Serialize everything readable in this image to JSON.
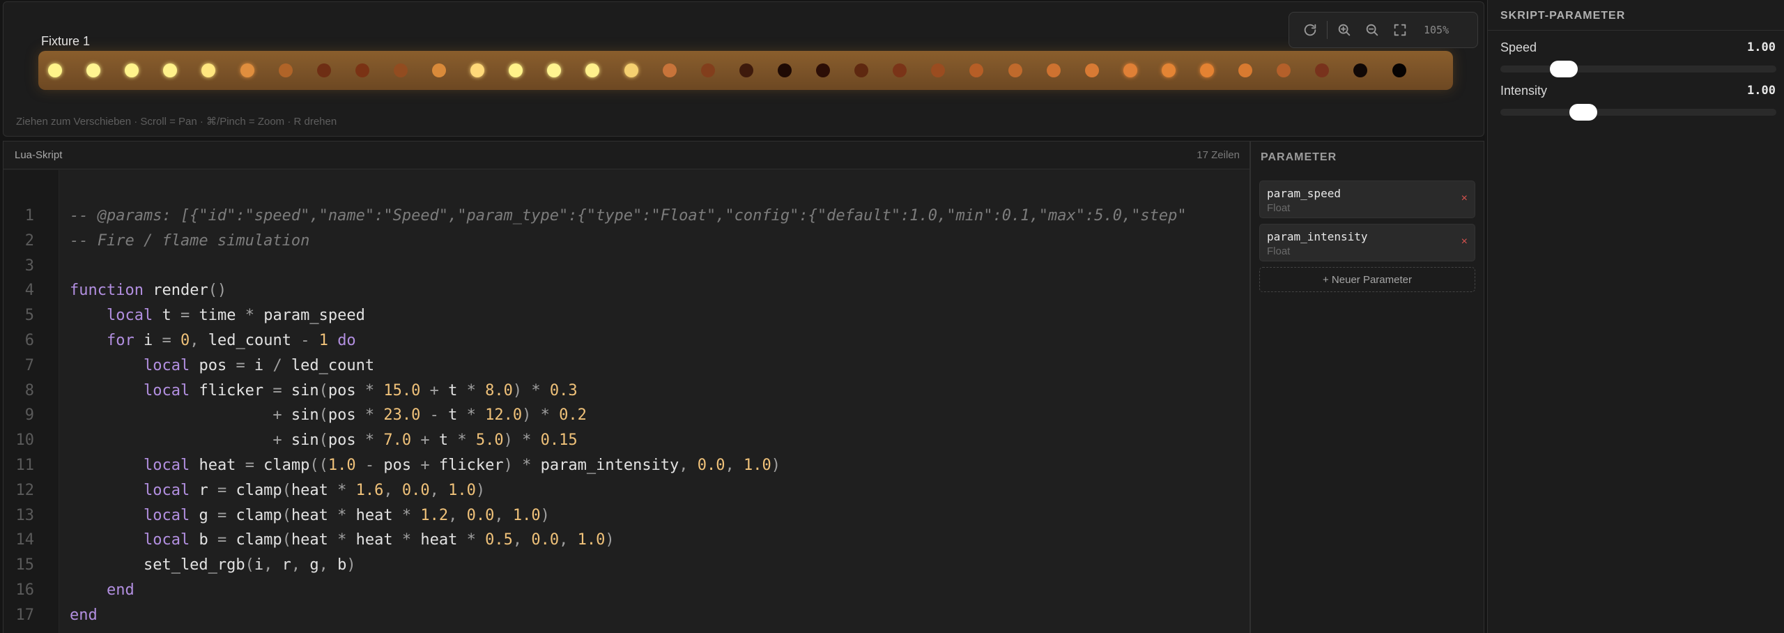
{
  "preview": {
    "fixture_name": "Fixture 1",
    "hint": "Ziehen zum Verschieben · Scroll = Pan · ⌘/Pinch = Zoom · R drehen",
    "zoom": "105%",
    "toolbar_icons": [
      "refresh-icon",
      "zoom-in-icon",
      "zoom-out-icon",
      "fit-screen-icon"
    ],
    "led_colors": [
      "#fff48a",
      "#fff591",
      "#fff48c",
      "#fff18a",
      "#ffe67f",
      "#e08e3e",
      "#b06428",
      "#6e2e14",
      "#7a3214",
      "#924c20",
      "#d98a3a",
      "#ffd979",
      "#fff38a",
      "#fff490",
      "#fff18c",
      "#f5d070",
      "#c8743a",
      "#823e1c",
      "#3e1a0c",
      "#1e0a04",
      "#2c0e06",
      "#5e2810",
      "#7a3418",
      "#9a4c20",
      "#b65e26",
      "#c06a2c",
      "#ce7230",
      "#d87a34",
      "#e08036",
      "#e48434",
      "#e48232",
      "#d87a30",
      "#b4602a",
      "#78321c",
      "#100806",
      "#060302"
    ]
  },
  "editor": {
    "title": "Lua-Skript",
    "line_count_label": "17 Zeilen",
    "line_numbers": [
      "1",
      "2",
      "3",
      "4",
      "5",
      "6",
      "7",
      "8",
      "9",
      "10",
      "11",
      "12",
      "13",
      "14",
      "15",
      "16",
      "17"
    ],
    "lines": [
      [
        [
          "cm",
          "-- @params: [{\"id\":\"speed\",\"name\":\"Speed\",\"param_type\":{\"type\":\"Float\",\"config\":{\"default\":1.0,\"min\":0.1,\"max\":5.0,\"step\""
        ]
      ],
      [
        [
          "cm",
          "-- Fire / flame simulation"
        ]
      ],
      [],
      [
        [
          "kw",
          "function"
        ],
        [
          "tx",
          " render"
        ],
        [
          "op",
          "()"
        ]
      ],
      [
        [
          "tx",
          "    "
        ],
        [
          "kw",
          "local"
        ],
        [
          "tx",
          " t "
        ],
        [
          "op",
          "="
        ],
        [
          "tx",
          " time "
        ],
        [
          "op",
          "*"
        ],
        [
          "tx",
          " param_speed"
        ]
      ],
      [
        [
          "tx",
          "    "
        ],
        [
          "kw",
          "for"
        ],
        [
          "tx",
          " i "
        ],
        [
          "op",
          "="
        ],
        [
          "tx",
          " "
        ],
        [
          "nm",
          "0"
        ],
        [
          "op",
          ","
        ],
        [
          "tx",
          " led_count "
        ],
        [
          "op",
          "-"
        ],
        [
          "tx",
          " "
        ],
        [
          "nm",
          "1"
        ],
        [
          "tx",
          " "
        ],
        [
          "kw",
          "do"
        ]
      ],
      [
        [
          "tx",
          "        "
        ],
        [
          "kw",
          "local"
        ],
        [
          "tx",
          " pos "
        ],
        [
          "op",
          "="
        ],
        [
          "tx",
          " i "
        ],
        [
          "op",
          "/"
        ],
        [
          "tx",
          " led_count"
        ]
      ],
      [
        [
          "tx",
          "        "
        ],
        [
          "kw",
          "local"
        ],
        [
          "tx",
          " flicker "
        ],
        [
          "op",
          "="
        ],
        [
          "tx",
          " sin"
        ],
        [
          "op",
          "("
        ],
        [
          "tx",
          "pos "
        ],
        [
          "op",
          "*"
        ],
        [
          "tx",
          " "
        ],
        [
          "nm",
          "15.0"
        ],
        [
          "tx",
          " "
        ],
        [
          "op",
          "+"
        ],
        [
          "tx",
          " t "
        ],
        [
          "op",
          "*"
        ],
        [
          "tx",
          " "
        ],
        [
          "nm",
          "8.0"
        ],
        [
          "op",
          ")"
        ],
        [
          "tx",
          " "
        ],
        [
          "op",
          "*"
        ],
        [
          "tx",
          " "
        ],
        [
          "nm",
          "0.3"
        ]
      ],
      [
        [
          "tx",
          "                      "
        ],
        [
          "op",
          "+"
        ],
        [
          "tx",
          " sin"
        ],
        [
          "op",
          "("
        ],
        [
          "tx",
          "pos "
        ],
        [
          "op",
          "*"
        ],
        [
          "tx",
          " "
        ],
        [
          "nm",
          "23.0"
        ],
        [
          "tx",
          " "
        ],
        [
          "op",
          "-"
        ],
        [
          "tx",
          " t "
        ],
        [
          "op",
          "*"
        ],
        [
          "tx",
          " "
        ],
        [
          "nm",
          "12.0"
        ],
        [
          "op",
          ")"
        ],
        [
          "tx",
          " "
        ],
        [
          "op",
          "*"
        ],
        [
          "tx",
          " "
        ],
        [
          "nm",
          "0.2"
        ]
      ],
      [
        [
          "tx",
          "                      "
        ],
        [
          "op",
          "+"
        ],
        [
          "tx",
          " sin"
        ],
        [
          "op",
          "("
        ],
        [
          "tx",
          "pos "
        ],
        [
          "op",
          "*"
        ],
        [
          "tx",
          " "
        ],
        [
          "nm",
          "7.0"
        ],
        [
          "tx",
          " "
        ],
        [
          "op",
          "+"
        ],
        [
          "tx",
          " t "
        ],
        [
          "op",
          "*"
        ],
        [
          "tx",
          " "
        ],
        [
          "nm",
          "5.0"
        ],
        [
          "op",
          ")"
        ],
        [
          "tx",
          " "
        ],
        [
          "op",
          "*"
        ],
        [
          "tx",
          " "
        ],
        [
          "nm",
          "0.15"
        ]
      ],
      [
        [
          "tx",
          "        "
        ],
        [
          "kw",
          "local"
        ],
        [
          "tx",
          " heat "
        ],
        [
          "op",
          "="
        ],
        [
          "tx",
          " clamp"
        ],
        [
          "op",
          "(("
        ],
        [
          "nm",
          "1.0"
        ],
        [
          "tx",
          " "
        ],
        [
          "op",
          "-"
        ],
        [
          "tx",
          " pos "
        ],
        [
          "op",
          "+"
        ],
        [
          "tx",
          " flicker"
        ],
        [
          "op",
          ")"
        ],
        [
          "tx",
          " "
        ],
        [
          "op",
          "*"
        ],
        [
          "tx",
          " param_intensity"
        ],
        [
          "op",
          ","
        ],
        [
          "tx",
          " "
        ],
        [
          "nm",
          "0.0"
        ],
        [
          "op",
          ","
        ],
        [
          "tx",
          " "
        ],
        [
          "nm",
          "1.0"
        ],
        [
          "op",
          ")"
        ]
      ],
      [
        [
          "tx",
          "        "
        ],
        [
          "kw",
          "local"
        ],
        [
          "tx",
          " r "
        ],
        [
          "op",
          "="
        ],
        [
          "tx",
          " clamp"
        ],
        [
          "op",
          "("
        ],
        [
          "tx",
          "heat "
        ],
        [
          "op",
          "*"
        ],
        [
          "tx",
          " "
        ],
        [
          "nm",
          "1.6"
        ],
        [
          "op",
          ","
        ],
        [
          "tx",
          " "
        ],
        [
          "nm",
          "0.0"
        ],
        [
          "op",
          ","
        ],
        [
          "tx",
          " "
        ],
        [
          "nm",
          "1.0"
        ],
        [
          "op",
          ")"
        ]
      ],
      [
        [
          "tx",
          "        "
        ],
        [
          "kw",
          "local"
        ],
        [
          "tx",
          " g "
        ],
        [
          "op",
          "="
        ],
        [
          "tx",
          " clamp"
        ],
        [
          "op",
          "("
        ],
        [
          "tx",
          "heat "
        ],
        [
          "op",
          "*"
        ],
        [
          "tx",
          " heat "
        ],
        [
          "op",
          "*"
        ],
        [
          "tx",
          " "
        ],
        [
          "nm",
          "1.2"
        ],
        [
          "op",
          ","
        ],
        [
          "tx",
          " "
        ],
        [
          "nm",
          "0.0"
        ],
        [
          "op",
          ","
        ],
        [
          "tx",
          " "
        ],
        [
          "nm",
          "1.0"
        ],
        [
          "op",
          ")"
        ]
      ],
      [
        [
          "tx",
          "        "
        ],
        [
          "kw",
          "local"
        ],
        [
          "tx",
          " b "
        ],
        [
          "op",
          "="
        ],
        [
          "tx",
          " clamp"
        ],
        [
          "op",
          "("
        ],
        [
          "tx",
          "heat "
        ],
        [
          "op",
          "*"
        ],
        [
          "tx",
          " heat "
        ],
        [
          "op",
          "*"
        ],
        [
          "tx",
          " heat "
        ],
        [
          "op",
          "*"
        ],
        [
          "tx",
          " "
        ],
        [
          "nm",
          "0.5"
        ],
        [
          "op",
          ","
        ],
        [
          "tx",
          " "
        ],
        [
          "nm",
          "0.0"
        ],
        [
          "op",
          ","
        ],
        [
          "tx",
          " "
        ],
        [
          "nm",
          "1.0"
        ],
        [
          "op",
          ")"
        ]
      ],
      [
        [
          "tx",
          "        set_led_rgb"
        ],
        [
          "op",
          "("
        ],
        [
          "tx",
          "i"
        ],
        [
          "op",
          ","
        ],
        [
          "tx",
          " r"
        ],
        [
          "op",
          ","
        ],
        [
          "tx",
          " g"
        ],
        [
          "op",
          ","
        ],
        [
          "tx",
          " b"
        ],
        [
          "op",
          ")"
        ]
      ],
      [
        [
          "tx",
          "    "
        ],
        [
          "kw",
          "end"
        ]
      ],
      [
        [
          "kw",
          "end"
        ]
      ]
    ]
  },
  "param_panel": {
    "heading": "PARAMETER",
    "items": [
      {
        "name": "param_speed",
        "type": "Float",
        "remove": "×"
      },
      {
        "name": "param_intensity",
        "type": "Float",
        "remove": "×"
      }
    ],
    "add_label": "+ Neuer Parameter"
  },
  "script_params": {
    "heading": "SKRIPT-PARAMETER",
    "sliders": [
      {
        "label": "Speed",
        "value": "1.00",
        "fraction": 0.18
      },
      {
        "label": "Intensity",
        "value": "1.00",
        "fraction": 0.25
      }
    ]
  }
}
